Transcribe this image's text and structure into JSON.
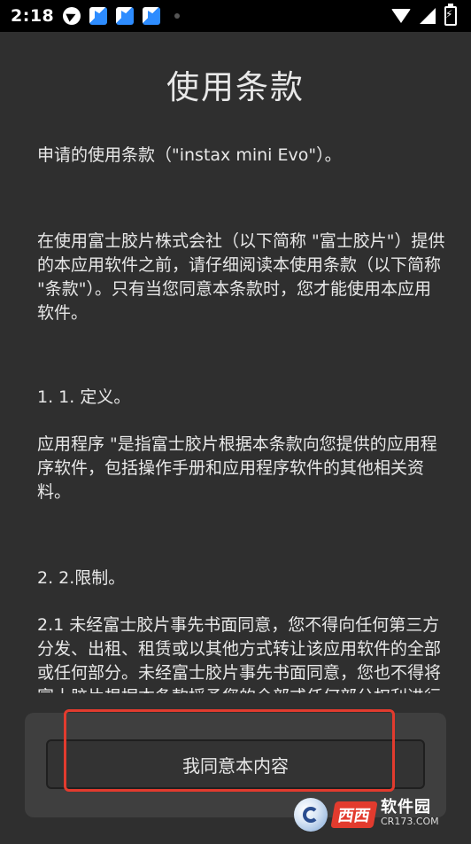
{
  "status_bar": {
    "time": "2:18"
  },
  "page": {
    "title": "使用条款"
  },
  "terms": {
    "intro": "申请的使用条款（\"instax mini Evo\"）。",
    "using": "在使用富士胶片株式会社（以下简称 \"富士胶片\"）提供的本应用软件之前，请仔细阅读本使用条款（以下简称 \"条款\"）。只有当您同意本条款时，您才能使用本应用软件。",
    "section1_heading": "1. 1. 定义。",
    "section1_body": "应用程序 \"是指富士胶片根据本条款向您提供的应用程序软件，包括操作手册和应用程序软件的其他相关资料。",
    "section2_heading": "2. 2.限制。",
    "section2_body": "2.1 未经富士胶片事先书面同意，您不得向任何第三方分发、出租、租赁或以其他方式转让该应用软件的全部或任何部分。未经富士胶片事先书面同意，您也不得将富士胶片根据本条款授予您的全部或任何部分权利进行再许可、转让或以其他方式转"
  },
  "footer": {
    "agree_label": "我同意本内容"
  },
  "watermark": {
    "mark": "西西",
    "name": "软件园",
    "url": "CR173.COM"
  },
  "colors": {
    "background": "#2f2f2f",
    "panel": "#3f3f3f",
    "highlight": "#e23b2e"
  }
}
